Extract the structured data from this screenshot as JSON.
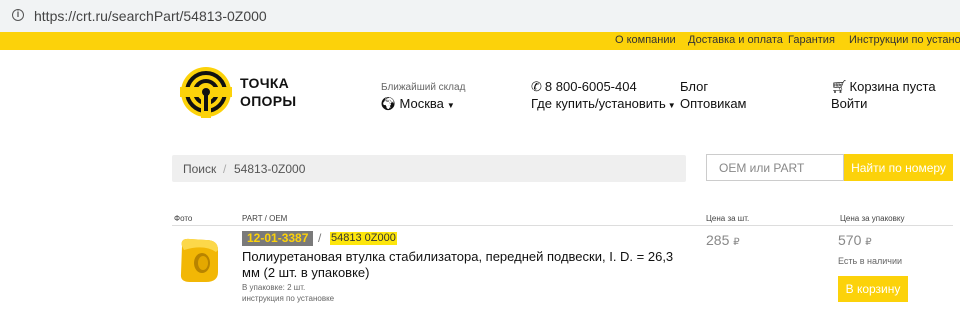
{
  "browser": {
    "url": "https://crt.ru/searchPart/54813-0Z000"
  },
  "topnav": {
    "items": [
      "О компании",
      "Доставка и оплата",
      "Гарантия",
      "Инструкции по установке"
    ]
  },
  "header": {
    "logo_line1": "ТОЧКА",
    "logo_line2": "ОПОРЫ",
    "warehouse_label": "Ближайший склад",
    "warehouse_city": "Москва",
    "phone": "8 800-6005-404",
    "where_buy": "Где купить/установить",
    "blog": "Блог",
    "wholesale": "Оптовикам",
    "cart": "Корзина пуста",
    "login": "Войти"
  },
  "search": {
    "breadcrumb_root": "Поиск",
    "separator": "/",
    "query": "54813-0Z000",
    "oem_placeholder": "OEM или PART",
    "find_button": "Найти по номеру"
  },
  "table": {
    "headers": {
      "photo": "Фото",
      "part": "PART / OEM",
      "unit_price": "Цена за шт.",
      "pack_price": "Цена за упаковку"
    },
    "rows": [
      {
        "part_code": "12-01-3387",
        "separator": "/",
        "oem_code": "54813 0Z000",
        "title": "Полиуретановая втулка стабилизатора, передней подвески, I. D. = 26,3 мм (2 шт. в упаковке)",
        "pack_info": "В упаковке: 2 шт.",
        "install_link": "инструкция по установке",
        "unit_price": "285",
        "pack_price": "570",
        "currency": "₽",
        "availability": "Есть в наличии",
        "cart_button": "В корзину"
      }
    ]
  },
  "colors": {
    "brand_yellow": "#fcd20a",
    "badge_gray": "#7a7a7a"
  }
}
